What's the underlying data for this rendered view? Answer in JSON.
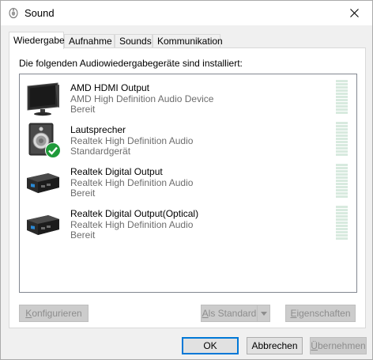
{
  "window": {
    "title": "Sound"
  },
  "tabs": [
    {
      "label": "Wiedergabe",
      "active": true
    },
    {
      "label": "Aufnahme"
    },
    {
      "label": "Sounds"
    },
    {
      "label": "Kommunikation"
    }
  ],
  "panel": {
    "heading": "Die folgenden Audiowiedergabegeräte sind installiert:",
    "devices": [
      {
        "name": "AMD HDMI Output",
        "description": "AMD High Definition Audio Device",
        "status": "Bereit",
        "icon": "monitor-icon"
      },
      {
        "name": "Lautsprecher",
        "description": "Realtek High Definition Audio",
        "status": "Standardgerät",
        "icon": "speaker-icon",
        "default": true
      },
      {
        "name": "Realtek Digital Output",
        "description": "Realtek High Definition Audio",
        "status": "Bereit",
        "icon": "digital-output-icon"
      },
      {
        "name": "Realtek Digital Output(Optical)",
        "description": "Realtek High Definition Audio",
        "status": "Bereit",
        "icon": "digital-output-icon"
      }
    ]
  },
  "buttons": {
    "configure": {
      "first": "K",
      "rest": "onfigurieren"
    },
    "set_default": {
      "first": "A",
      "rest": "ls Standard"
    },
    "properties": {
      "first": "E",
      "rest": "igenschaften"
    },
    "ok": "OK",
    "cancel": "Abbrechen",
    "apply": {
      "first": "Ü",
      "rest": "bernehmen"
    }
  },
  "colors": {
    "accent": "#0078d7",
    "meter": "#d8eadf",
    "default_check": "#1f9a3a"
  }
}
